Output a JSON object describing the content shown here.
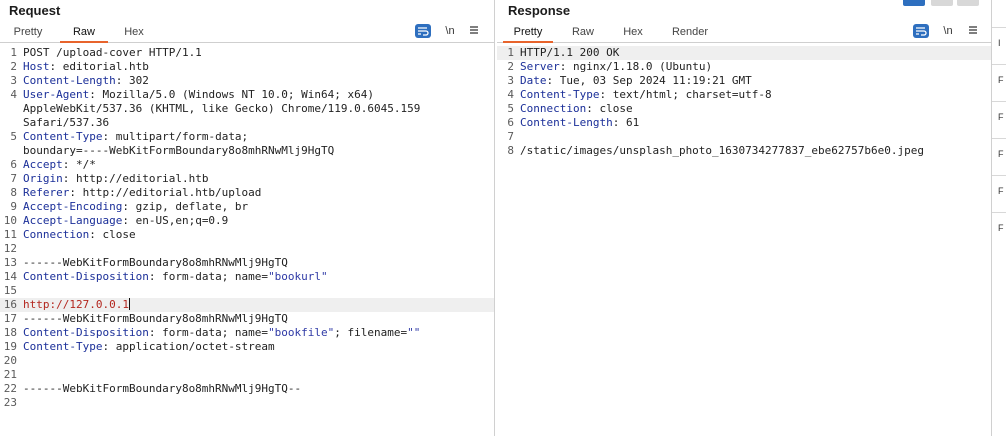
{
  "request": {
    "title": "Request",
    "tabs": [
      "Pretty",
      "Raw",
      "Hex"
    ],
    "active_tab": "Raw",
    "wrap_icon": "wrap-lines-icon",
    "newline_label": "\\n",
    "menu_icon": "menu-icon",
    "lines": [
      {
        "n": "1",
        "parts": [
          {
            "t": "POST /upload-cover HTTP/1.1"
          }
        ]
      },
      {
        "n": "2",
        "parts": [
          {
            "t": "Host",
            "c": "key"
          },
          {
            "t": ": editorial.htb"
          }
        ]
      },
      {
        "n": "3",
        "parts": [
          {
            "t": "Content-Length",
            "c": "key"
          },
          {
            "t": ": 302"
          }
        ]
      },
      {
        "n": "4",
        "parts": [
          {
            "t": "User-Agent",
            "c": "key"
          },
          {
            "t": ": Mozilla/5.0 (Windows NT 10.0; Win64; x64)"
          }
        ]
      },
      {
        "n": "",
        "parts": [
          {
            "t": "AppleWebKit/537.36 (KHTML, like Gecko) Chrome/119.0.6045.159"
          }
        ]
      },
      {
        "n": "",
        "parts": [
          {
            "t": "Safari/537.36"
          }
        ]
      },
      {
        "n": "5",
        "parts": [
          {
            "t": "Content-Type",
            "c": "key"
          },
          {
            "t": ": multipart/form-data;"
          }
        ]
      },
      {
        "n": "",
        "parts": [
          {
            "t": "boundary=----WebKitFormBoundary8o8mhRNwMlj9HgTQ"
          }
        ]
      },
      {
        "n": "6",
        "parts": [
          {
            "t": "Accept",
            "c": "key"
          },
          {
            "t": ": */*"
          }
        ]
      },
      {
        "n": "7",
        "parts": [
          {
            "t": "Origin",
            "c": "key"
          },
          {
            "t": ": http://editorial.htb"
          }
        ]
      },
      {
        "n": "8",
        "parts": [
          {
            "t": "Referer",
            "c": "key"
          },
          {
            "t": ": http://editorial.htb/upload"
          }
        ]
      },
      {
        "n": "9",
        "parts": [
          {
            "t": "Accept-Encoding",
            "c": "key"
          },
          {
            "t": ": gzip, deflate, br"
          }
        ]
      },
      {
        "n": "10",
        "parts": [
          {
            "t": "Accept-Language",
            "c": "key"
          },
          {
            "t": ": en-US,en;q=0.9"
          }
        ]
      },
      {
        "n": "11",
        "parts": [
          {
            "t": "Connection",
            "c": "key"
          },
          {
            "t": ": close"
          }
        ]
      },
      {
        "n": "12",
        "parts": []
      },
      {
        "n": "13",
        "parts": [
          {
            "t": "------WebKitFormBoundary8o8mhRNwMlj9HgTQ"
          }
        ]
      },
      {
        "n": "14",
        "parts": [
          {
            "t": "Content-Disposition",
            "c": "key"
          },
          {
            "t": ": form-data; name="
          },
          {
            "t": "\"bookurl\"",
            "c": "attr"
          }
        ]
      },
      {
        "n": "15",
        "parts": []
      },
      {
        "n": "16",
        "parts": [
          {
            "t": "http://127.0.0.1",
            "c": "red"
          }
        ],
        "highlight": true,
        "cursor": true
      },
      {
        "n": "17",
        "parts": [
          {
            "t": "------WebKitFormBoundary8o8mhRNwMlj9HgTQ"
          }
        ]
      },
      {
        "n": "18",
        "parts": [
          {
            "t": "Content-Disposition",
            "c": "key"
          },
          {
            "t": ": form-data; name="
          },
          {
            "t": "\"bookfile\"",
            "c": "attr"
          },
          {
            "t": "; filename="
          },
          {
            "t": "\"\"",
            "c": "attr"
          }
        ]
      },
      {
        "n": "19",
        "parts": [
          {
            "t": "Content-Type",
            "c": "key"
          },
          {
            "t": ": application/octet-stream"
          }
        ]
      },
      {
        "n": "20",
        "parts": []
      },
      {
        "n": "21",
        "parts": []
      },
      {
        "n": "22",
        "parts": [
          {
            "t": "------WebKitFormBoundary8o8mhRNwMlj9HgTQ--"
          }
        ]
      },
      {
        "n": "23",
        "parts": []
      }
    ]
  },
  "response": {
    "title": "Response",
    "tabs": [
      "Pretty",
      "Raw",
      "Hex",
      "Render"
    ],
    "active_tab": "Pretty",
    "wrap_icon": "wrap-lines-icon",
    "newline_label": "\\n",
    "menu_icon": "menu-icon",
    "lines": [
      {
        "n": "1",
        "parts": [
          {
            "t": "HTTP/1.1 200 OK"
          }
        ],
        "highlight": true
      },
      {
        "n": "2",
        "parts": [
          {
            "t": "Server",
            "c": "key"
          },
          {
            "t": ": nginx/1.18.0 (Ubuntu)"
          }
        ]
      },
      {
        "n": "3",
        "parts": [
          {
            "t": "Date",
            "c": "key"
          },
          {
            "t": ": Tue, 03 Sep 2024 11:19:21 GMT"
          }
        ]
      },
      {
        "n": "4",
        "parts": [
          {
            "t": "Content-Type",
            "c": "key"
          },
          {
            "t": ": text/html; charset=utf-8"
          }
        ]
      },
      {
        "n": "5",
        "parts": [
          {
            "t": "Connection",
            "c": "key"
          },
          {
            "t": ": close"
          }
        ]
      },
      {
        "n": "6",
        "parts": [
          {
            "t": "Content-Length",
            "c": "key"
          },
          {
            "t": ": 61"
          }
        ]
      },
      {
        "n": "7",
        "parts": []
      },
      {
        "n": "8",
        "parts": [
          {
            "t": "/static/images/unsplash_photo_1630734277837_ebe62757b6e0.jpeg"
          }
        ]
      }
    ]
  },
  "right_strip": {
    "items": [
      "I",
      "F",
      "F",
      "F",
      "F",
      "F"
    ]
  }
}
